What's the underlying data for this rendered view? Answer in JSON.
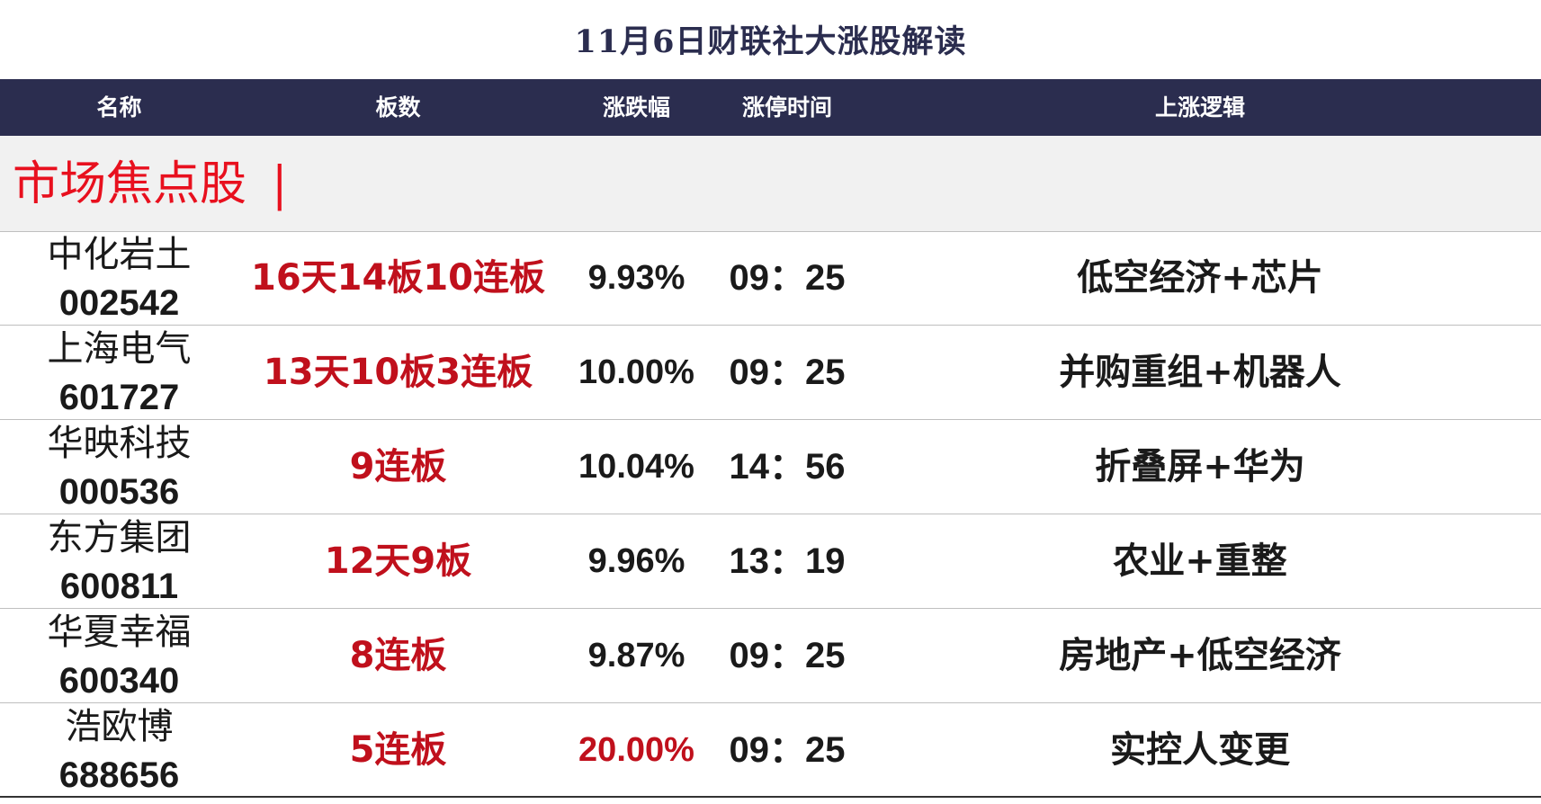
{
  "title": "11月6日财联社大涨股解读",
  "header": {
    "name": "名称",
    "boards": "板数",
    "change": "涨跌幅",
    "limit_time": "涨停时间",
    "logic": "上涨逻辑"
  },
  "section": {
    "title": "市场焦点股",
    "separator": "|"
  },
  "colors": {
    "header_bg": "#2b2d4f",
    "accent_red": "#c0101c",
    "section_red": "#e8101e",
    "section_bg": "#f1f1f1"
  },
  "rows": [
    {
      "name": "中化岩土",
      "code": "002542",
      "boards": "16天14板10连板",
      "change": "9.93%",
      "change_red": false,
      "time": "09：25",
      "logic": "低空经济+芯片"
    },
    {
      "name": "上海电气",
      "code": "601727",
      "boards": "13天10板3连板",
      "change": "10.00%",
      "change_red": false,
      "time": "09：25",
      "logic": "并购重组+机器人"
    },
    {
      "name": "华映科技",
      "code": "000536",
      "boards": "9连板",
      "change": "10.04%",
      "change_red": false,
      "time": "14：56",
      "logic": "折叠屏+华为"
    },
    {
      "name": "东方集团",
      "code": "600811",
      "boards": "12天9板",
      "change": "9.96%",
      "change_red": false,
      "time": "13：19",
      "logic": "农业+重整"
    },
    {
      "name": "华夏幸福",
      "code": "600340",
      "boards": "8连板",
      "change": "9.87%",
      "change_red": false,
      "time": "09：25",
      "logic": "房地产+低空经济"
    },
    {
      "name": "浩欧博",
      "code": "688656",
      "boards": "5连板",
      "change": "20.00%",
      "change_red": true,
      "time": "09：25",
      "logic": "实控人变更"
    }
  ]
}
